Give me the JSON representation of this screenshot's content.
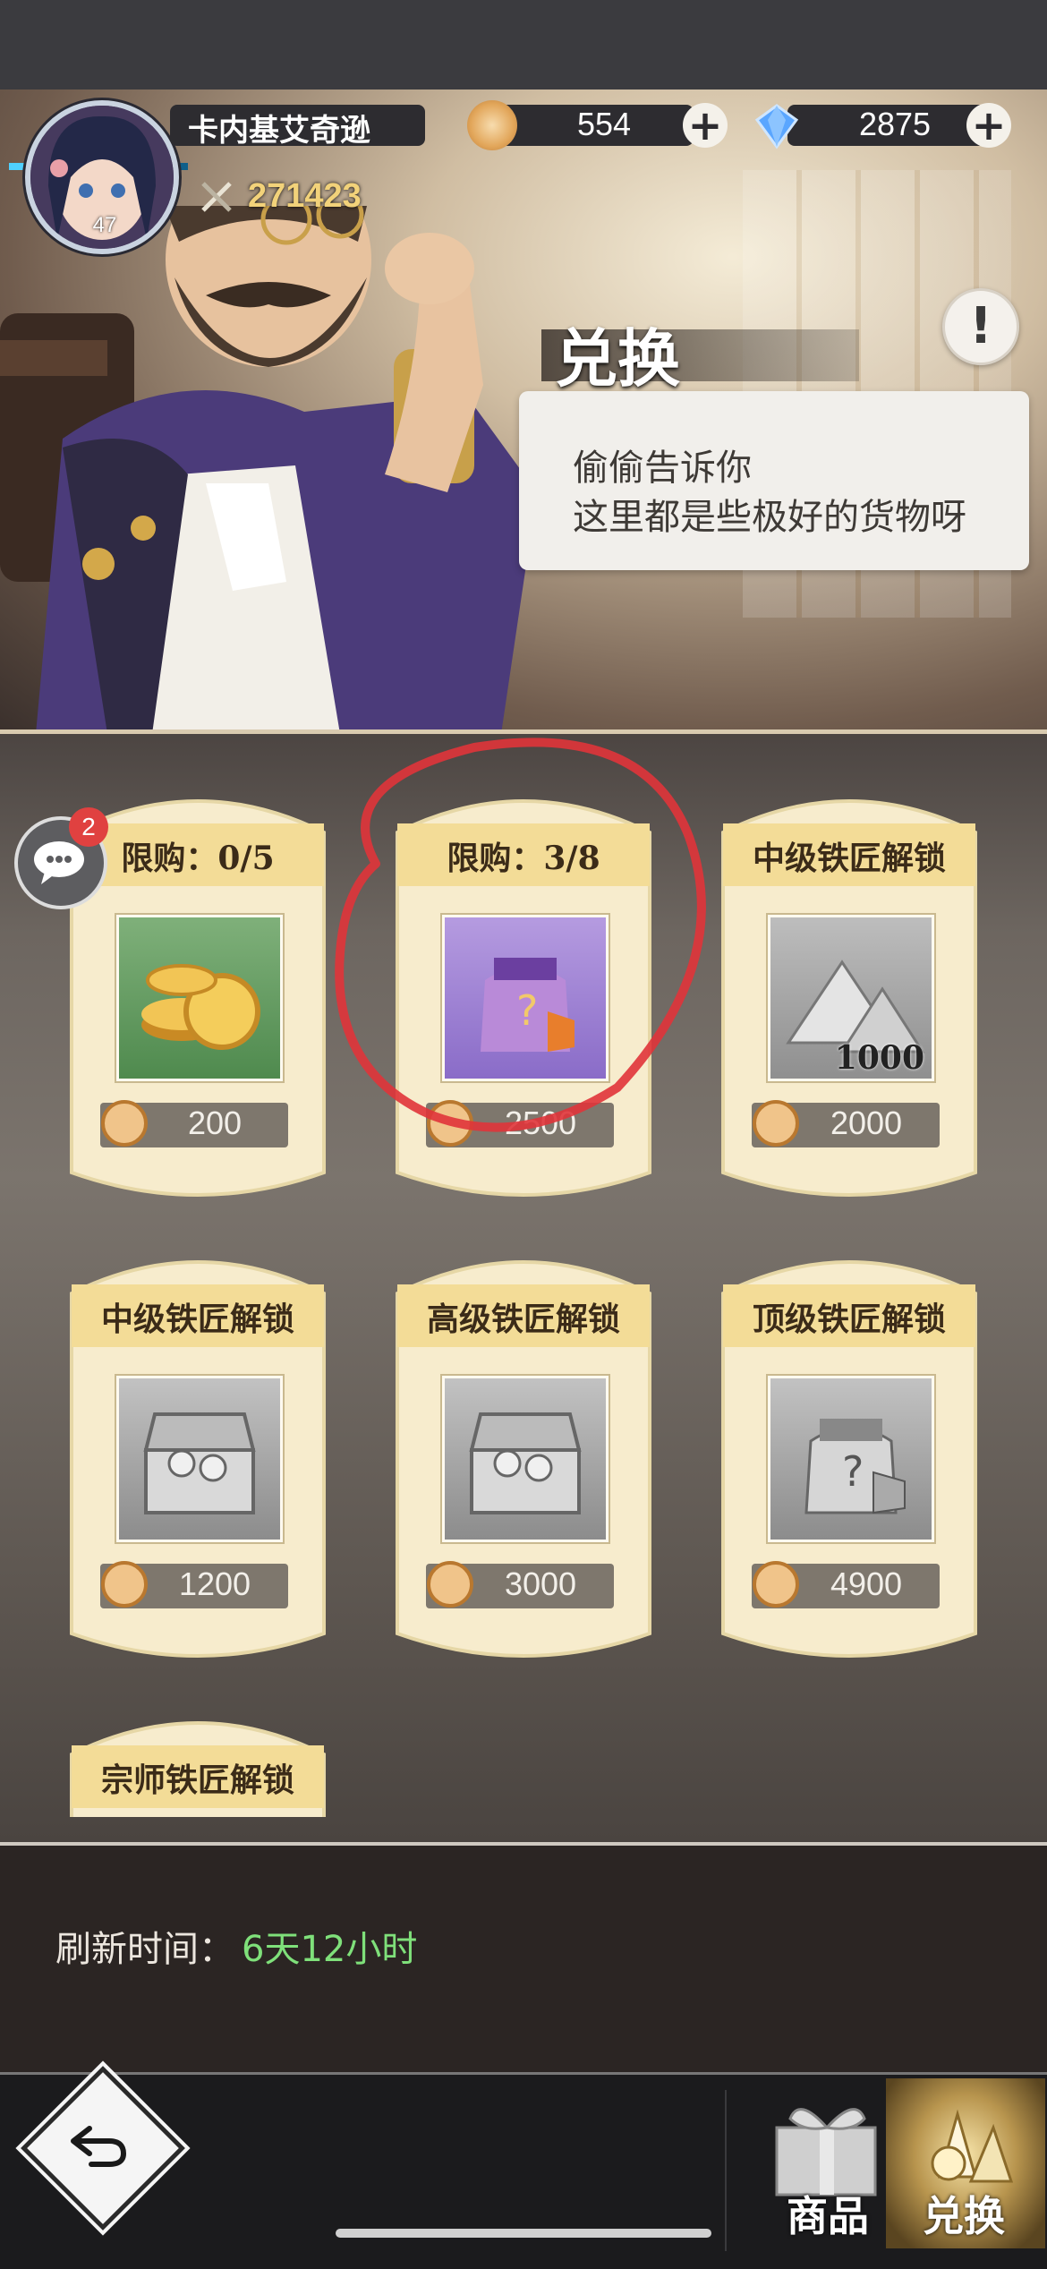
{
  "player": {
    "name": "卡内基艾奇逊",
    "level": "47",
    "power": "271423"
  },
  "currencies": {
    "coin": "554",
    "diamond": "2875"
  },
  "header": {
    "title": "兑换",
    "info_label": "!",
    "speech_line1": "偷偷告诉你",
    "speech_line2": "这里都是些极好的货物呀"
  },
  "chat": {
    "badge": "2"
  },
  "items": [
    {
      "title": "限购：0/5",
      "price": "200",
      "icon": "gold-coins-icon"
    },
    {
      "title": "限购：3/8",
      "price": "2500",
      "icon": "mystery-bag-icon"
    },
    {
      "title": "中级铁匠解锁",
      "price": "2000",
      "icon": "ore-pile-icon",
      "qty": "1000"
    },
    {
      "title": "中级铁匠解锁",
      "price": "1200",
      "icon": "treasure-chest-icon"
    },
    {
      "title": "高级铁匠解锁",
      "price": "3000",
      "icon": "treasure-chest-icon"
    },
    {
      "title": "顶级铁匠解锁",
      "price": "4900",
      "icon": "mystery-bag-icon"
    },
    {
      "title": "宗师铁匠解锁"
    }
  ],
  "refresh": {
    "label": "刷新时间：",
    "value": "6天12小时"
  },
  "nav": {
    "shop_label": "商品",
    "exchange_label": "兑换"
  },
  "colors": {
    "card_cream": "#f7eccd",
    "title_gold": "#f3dc97",
    "refresh_green": "#7fe07a",
    "annotation_red": "#e0343a"
  }
}
